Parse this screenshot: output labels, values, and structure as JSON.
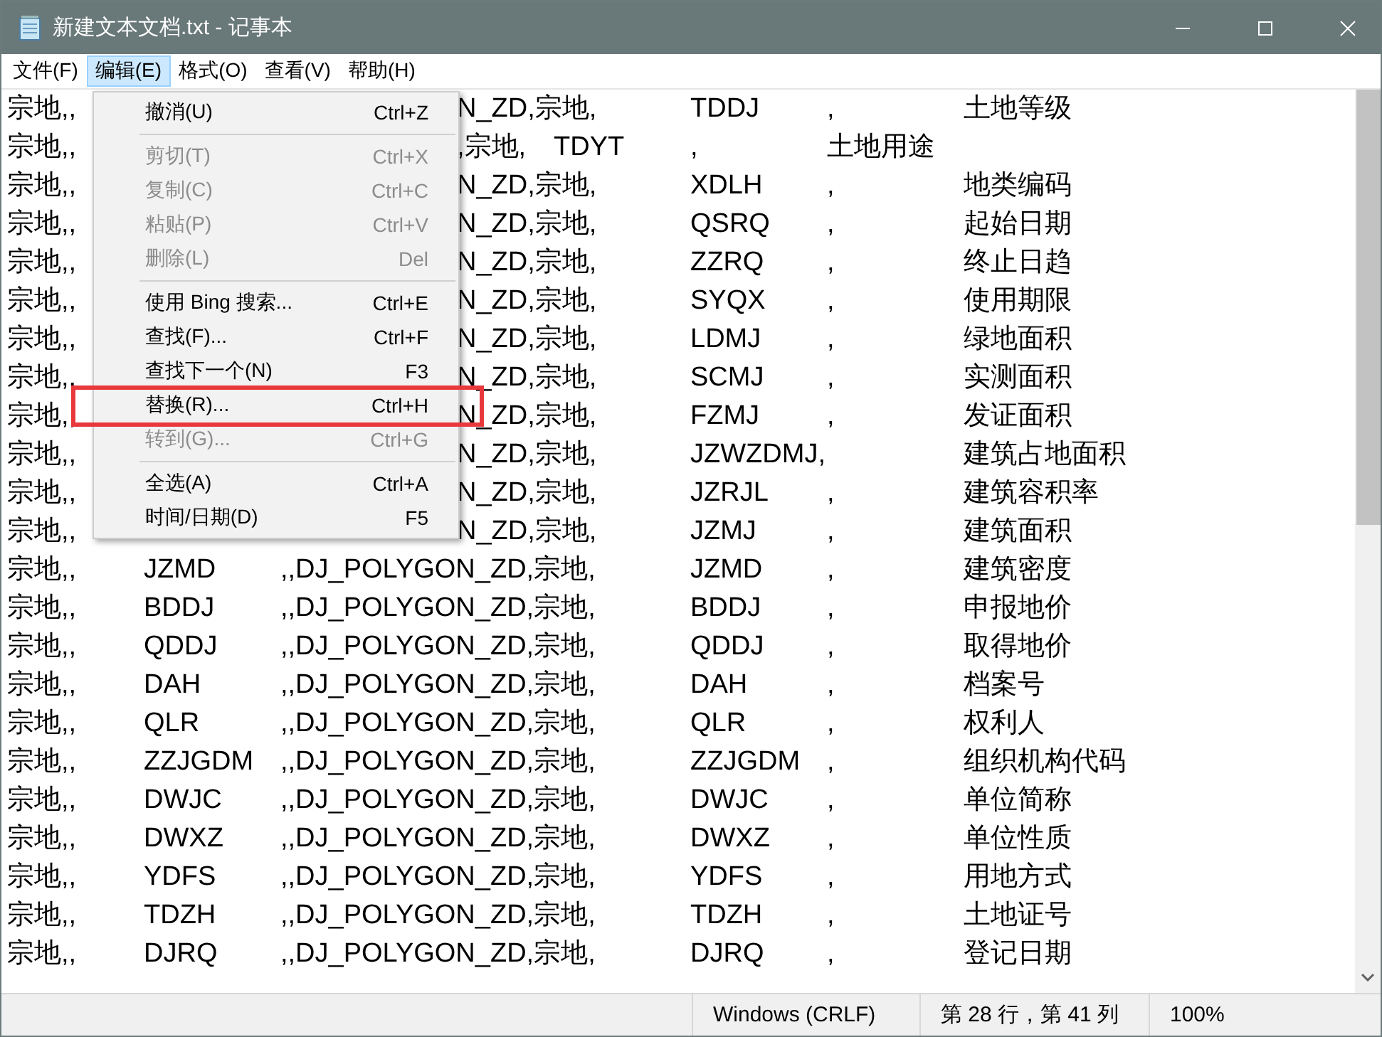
{
  "window": {
    "title": "新建文本文档.txt - 记事本"
  },
  "menu_bar": [
    {
      "label": "文件(F)",
      "selected": false
    },
    {
      "label": "编辑(E)",
      "selected": true
    },
    {
      "label": "格式(O)",
      "selected": false
    },
    {
      "label": "查看(V)",
      "selected": false
    },
    {
      "label": "帮助(H)",
      "selected": false
    }
  ],
  "edit_menu": {
    "items": [
      {
        "kind": "item",
        "label": "撤消(U)",
        "shortcut": "Ctrl+Z",
        "disabled": false,
        "annotated": false
      },
      {
        "kind": "separator"
      },
      {
        "kind": "item",
        "label": "剪切(T)",
        "shortcut": "Ctrl+X",
        "disabled": true,
        "annotated": false
      },
      {
        "kind": "item",
        "label": "复制(C)",
        "shortcut": "Ctrl+C",
        "disabled": true,
        "annotated": false
      },
      {
        "kind": "item",
        "label": "粘贴(P)",
        "shortcut": "Ctrl+V",
        "disabled": true,
        "annotated": false
      },
      {
        "kind": "item",
        "label": "删除(L)",
        "shortcut": "Del",
        "disabled": true,
        "annotated": false
      },
      {
        "kind": "separator"
      },
      {
        "kind": "item",
        "label": "使用 Bing 搜索...",
        "shortcut": "Ctrl+E",
        "disabled": false,
        "annotated": false
      },
      {
        "kind": "item",
        "label": "查找(F)...",
        "shortcut": "Ctrl+F",
        "disabled": false,
        "annotated": false
      },
      {
        "kind": "item",
        "label": "查找下一个(N)",
        "shortcut": "F3",
        "disabled": false,
        "annotated": false
      },
      {
        "kind": "item",
        "label": "替换(R)...",
        "shortcut": "Ctrl+H",
        "disabled": false,
        "annotated": true
      },
      {
        "kind": "item",
        "label": "转到(G)...",
        "shortcut": "Ctrl+G",
        "disabled": true,
        "annotated": false
      },
      {
        "kind": "separator"
      },
      {
        "kind": "item",
        "label": "全选(A)",
        "shortcut": "Ctrl+A",
        "disabled": false,
        "annotated": false
      },
      {
        "kind": "item",
        "label": "时间/日期(D)",
        "shortcut": "F5",
        "disabled": false,
        "annotated": false
      }
    ]
  },
  "editor": {
    "lines": [
      {
        "kind": "covered",
        "before_menu": "宗地,,",
        "after_menu": "N_ZD,宗地,\tTDDJ\t,\t土地等级"
      },
      {
        "kind": "covered",
        "before_menu": "宗地,,",
        "after_menu": ",宗地,\tTDYT\t,\t土地用途"
      },
      {
        "kind": "covered",
        "before_menu": "宗地,,",
        "after_menu": "N_ZD,宗地,\tXDLH\t,\t地类编码"
      },
      {
        "kind": "covered",
        "before_menu": "宗地,,",
        "after_menu": "N_ZD,宗地,\tQSRQ\t,\t起始日期"
      },
      {
        "kind": "covered",
        "before_menu": "宗地,,",
        "after_menu": "N_ZD,宗地,\tZZRQ\t,\t终止日趋"
      },
      {
        "kind": "covered",
        "before_menu": "宗地,,",
        "after_menu": "N_ZD,宗地,\tSYQX\t,\t使用期限"
      },
      {
        "kind": "covered",
        "before_menu": "宗地,,",
        "after_menu": "N_ZD,宗地,\tLDMJ\t,\t绿地面积"
      },
      {
        "kind": "covered",
        "before_menu": "宗地,,",
        "after_menu": "N_ZD,宗地,\tSCMJ\t,\t实测面积"
      },
      {
        "kind": "covered",
        "before_menu": "宗地,,",
        "after_menu": "N_ZD,宗地,\tFZMJ\t,\t发证面积"
      },
      {
        "kind": "covered",
        "before_menu": "宗地,,",
        "after_menu": "N_ZD,宗地,\tJZWZDMJ,\t建筑占地面积"
      },
      {
        "kind": "covered",
        "before_menu": "宗地,,",
        "after_menu": "N_ZD,宗地,\tJZRJL\t,\t建筑容积率"
      },
      {
        "kind": "covered",
        "before_menu": "宗地,,",
        "after_menu": "N_ZD,宗地,\tJZMJ\t,\t建筑面积"
      },
      {
        "kind": "full",
        "text": "宗地,,\tJZMD\t,,DJ_POLYGON_ZD,宗地,\tJZMD\t,\t建筑密度"
      },
      {
        "kind": "full",
        "text": "宗地,,\tBDDJ\t,,DJ_POLYGON_ZD,宗地,\tBDDJ\t,\t申报地价"
      },
      {
        "kind": "full",
        "text": "宗地,,\tQDDJ\t,,DJ_POLYGON_ZD,宗地,\tQDDJ\t,\t取得地价"
      },
      {
        "kind": "full",
        "text": "宗地,,\tDAH\t,,DJ_POLYGON_ZD,宗地,\tDAH\t,\t档案号"
      },
      {
        "kind": "full",
        "text": "宗地,,\tQLR\t,,DJ_POLYGON_ZD,宗地,\tQLR\t,\t权利人"
      },
      {
        "kind": "full",
        "text": "宗地,,\tZZJGDM\t,,DJ_POLYGON_ZD,宗地,\tZZJGDM\t,\t组织机构代码"
      },
      {
        "kind": "full",
        "text": "宗地,,\tDWJC\t,,DJ_POLYGON_ZD,宗地,\tDWJC\t,\t单位简称"
      },
      {
        "kind": "full",
        "text": "宗地,,\tDWXZ\t,,DJ_POLYGON_ZD,宗地,\tDWXZ\t,\t单位性质"
      },
      {
        "kind": "full",
        "text": "宗地,,\tYDFS\t,,DJ_POLYGON_ZD,宗地,\tYDFS\t,\t用地方式"
      },
      {
        "kind": "full",
        "text": "宗地,,\tTDZH\t,,DJ_POLYGON_ZD,宗地,\tTDZH\t,\t土地证号"
      },
      {
        "kind": "full",
        "text": "宗地,,\tDJRQ\t,,DJ_POLYGON_ZD,宗地,\tDJRQ\t,\t登记日期"
      }
    ]
  },
  "status_bar": {
    "line_ending": "Windows (CRLF)",
    "position": "第 28 行，第 41 列",
    "zoom": "100%"
  }
}
